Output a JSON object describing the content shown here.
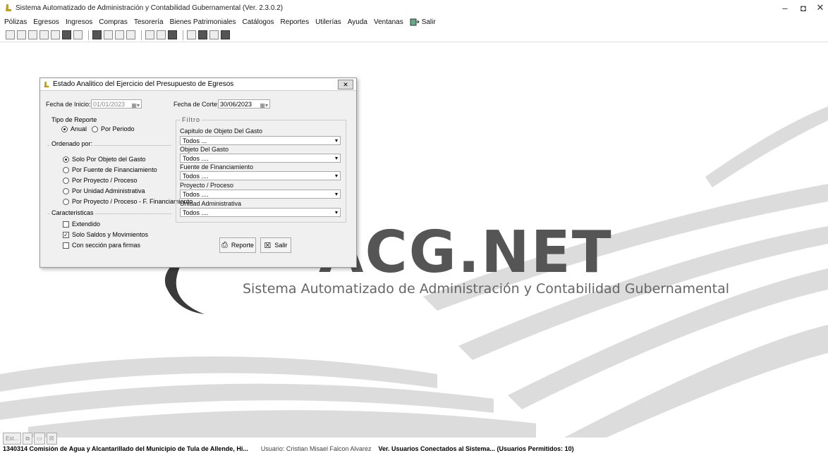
{
  "window": {
    "title": "Sistema Automatizado de Administración y Contabilidad Gubernamental  (Ver. 2.3.0.2)",
    "controls": {
      "minimize": "–",
      "maximize": "◘",
      "close": "✕"
    }
  },
  "menu": {
    "items": [
      "Pólizas",
      "Egresos",
      "Ingresos",
      "Compras",
      "Tesorería",
      "Bienes Patrimoniales",
      "Catálogos",
      "Reportes",
      "Utilerías",
      "Ayuda",
      "Ventanas"
    ],
    "exit_label": "Salir"
  },
  "background": {
    "logo_text": "ACG.NET",
    "subtitle": "Sistema Automatizado de Administración y Contabilidad Gubernamental"
  },
  "dialog": {
    "title": "Estado Analitico del Ejercicio del Presupuesto de Egresos",
    "fecha_inicio_label": "Fecha de Inicio:",
    "fecha_inicio_value": "01/01/2023",
    "fecha_corte_label": "Fecha de Corte:",
    "fecha_corte_value": "30/06/2023",
    "tipo_reporte": {
      "title": "Tipo de Reporte",
      "options": [
        "Anual",
        "Por Periodo"
      ],
      "selected": "Anual"
    },
    "ordenado_por": {
      "title": "Ordenado por:",
      "options": [
        "Solo Por Objeto del Gasto",
        "Por Fuente de Financiamiento",
        "Por Proyecto / Proceso",
        "Por Unidad Administrativa",
        "Por Proyecto / Proceso  -  F. Financiamiento"
      ],
      "selected": "Solo Por Objeto del Gasto"
    },
    "caracteristicas": {
      "title": "Caracteristicas",
      "options": [
        {
          "label": "Extendido",
          "checked": false
        },
        {
          "label": "Solo Saldos y Movimientos",
          "checked": true
        },
        {
          "label": "Con sección para firmas",
          "checked": false
        }
      ]
    },
    "filtro": {
      "title": "Filtro",
      "fields": [
        {
          "label": "Capitulo de Objeto Del Gasto",
          "value": "Todos ..."
        },
        {
          "label": "Objeto Del Gasto",
          "value": "Todos ...."
        },
        {
          "label": "Fuente de Financiamiento",
          "value": "Todos ...."
        },
        {
          "label": "Proyecto / Proceso",
          "value": "Todos ...."
        },
        {
          "label": "Unidad Administrativa",
          "value": "Todos ...."
        }
      ]
    },
    "buttons": {
      "report": "Reporte",
      "exit": "Salir"
    }
  },
  "taskbar": {
    "item_label": "Est..."
  },
  "statusbar": {
    "entity": "1340314 Comisión de Agua y Alcantarillado del Municipio de Tula de Allende, Hi...",
    "user": "Usuario: Cristian Misael Falcon Alvarez",
    "connected": "Ver. Usuarios Conectados al Sistema... (Usuarios Permitidos: 10)"
  }
}
